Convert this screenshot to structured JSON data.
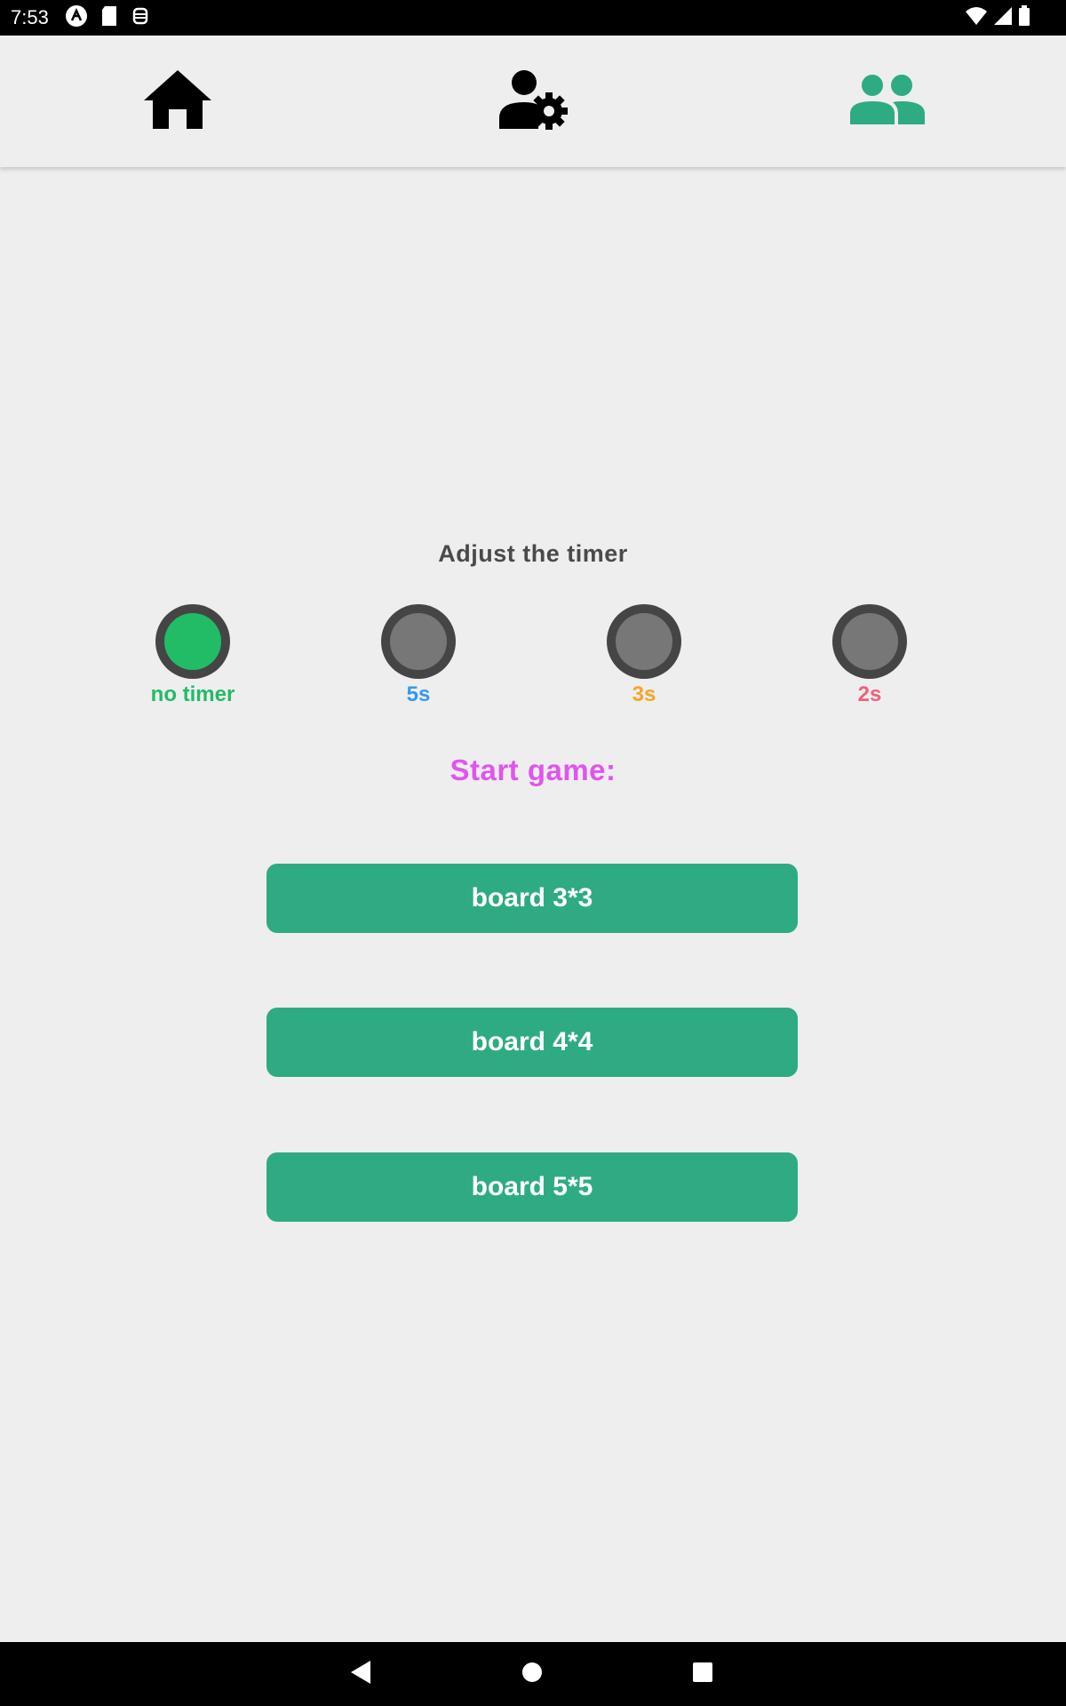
{
  "status_bar": {
    "time": "7:53"
  },
  "top_nav": {
    "tabs": [
      {
        "icon": "home-icon",
        "active": false
      },
      {
        "icon": "user-settings-icon",
        "active": false
      },
      {
        "icon": "group-icon",
        "active": true
      }
    ],
    "active_color": "#2eab82"
  },
  "timer": {
    "title": "Adjust the timer",
    "options": [
      {
        "label": "no timer",
        "color": "#22bb66",
        "selected": true
      },
      {
        "label": "5s",
        "color": "#3399ee",
        "selected": false
      },
      {
        "label": "3s",
        "color": "#f5a623",
        "selected": false
      },
      {
        "label": "2s",
        "color": "#f0607a",
        "selected": false
      }
    ]
  },
  "start": {
    "title": "Start game:",
    "buttons": [
      {
        "label": "board 3*3"
      },
      {
        "label": "board 4*4"
      },
      {
        "label": "board 5*5"
      }
    ]
  },
  "system_nav": {
    "buttons": [
      "back-icon",
      "home-circle-icon",
      "recents-icon"
    ]
  }
}
